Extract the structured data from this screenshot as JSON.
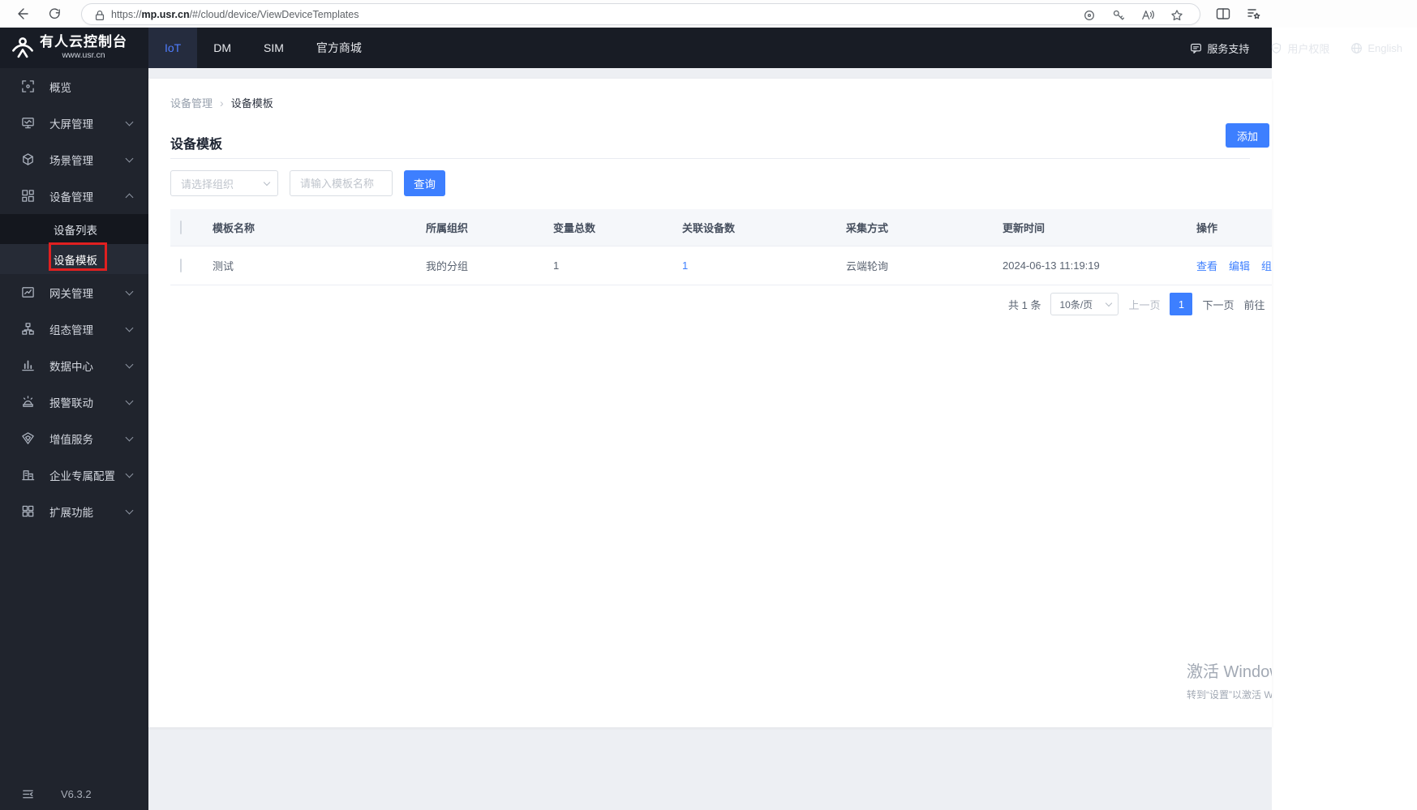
{
  "browser": {
    "url_prefix": "https://",
    "url_domain": "mp.usr.cn",
    "url_path": "/#/cloud/device/ViewDeviceTemplates"
  },
  "header": {
    "logo_title": "有人云控制台",
    "logo_subtitle": "www.usr.cn",
    "tabs": [
      {
        "label": "IoT"
      },
      {
        "label": "DM"
      },
      {
        "label": "SIM"
      },
      {
        "label": "官方商城"
      }
    ],
    "support_label": "服务支持",
    "permissions_label": "用户权限",
    "language_label": "English"
  },
  "sidebar": {
    "items": [
      {
        "label": "概览"
      },
      {
        "label": "大屏管理"
      },
      {
        "label": "场景管理"
      },
      {
        "label": "设备管理"
      },
      {
        "label": "网关管理"
      },
      {
        "label": "组态管理"
      },
      {
        "label": "数据中心"
      },
      {
        "label": "报警联动"
      },
      {
        "label": "增值服务"
      },
      {
        "label": "企业专属配置"
      },
      {
        "label": "扩展功能"
      }
    ],
    "device_submenu": [
      {
        "label": "设备列表"
      },
      {
        "label": "设备模板"
      }
    ],
    "version": "V6.3.2"
  },
  "page": {
    "breadcrumb": {
      "parent": "设备管理",
      "current": "设备模板"
    },
    "title": "设备模板",
    "add_button": "添加",
    "filters": {
      "org_placeholder": "请选择组织",
      "name_placeholder": "请输入模板名称",
      "search_button": "查询"
    },
    "table": {
      "headers": [
        "模板名称",
        "所属组织",
        "变量总数",
        "关联设备数",
        "采集方式",
        "更新时间",
        "操作"
      ],
      "rows": [
        {
          "name": "测试",
          "org": "我的分组",
          "variables": "1",
          "devices": "1",
          "method": "云端轮询",
          "updated": "2024-06-13 11:19:19",
          "actions": [
            "查看",
            "编辑",
            "组态"
          ]
        }
      ]
    },
    "pagination": {
      "total": "共 1 条",
      "page_size": "10条/页",
      "prev": "上一页",
      "current": "1",
      "next": "下一页",
      "goto": "前往"
    }
  },
  "watermark": {
    "line1": "激活 Windows",
    "line2": "转到“设置”以激活 Windows。"
  },
  "colors": {
    "accent": "#3d7fff",
    "link": "#3d7fff",
    "annotation_red": "#e02020",
    "header_bg": "#181c25",
    "sidebar_bg": "#20242d"
  }
}
